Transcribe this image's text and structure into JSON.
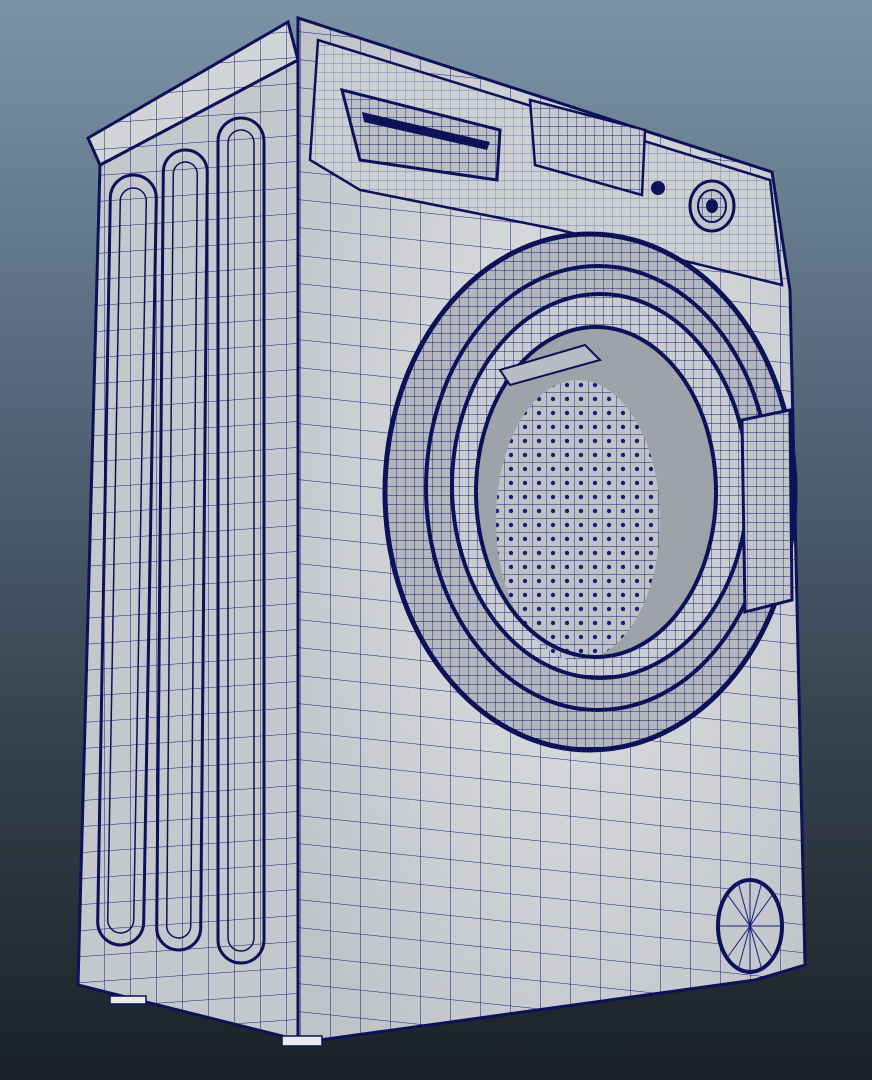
{
  "viewport": {
    "background_top": "#7d93a8",
    "background_bottom": "#1b2127"
  },
  "model": {
    "subject": "washing-machine",
    "surface_color": "#cfd1d4",
    "side_color": "#c4c7cb",
    "wire_color": "#141f7a",
    "edge_color": "#0b1258",
    "display_mode": "wireframe-on-shaded"
  }
}
